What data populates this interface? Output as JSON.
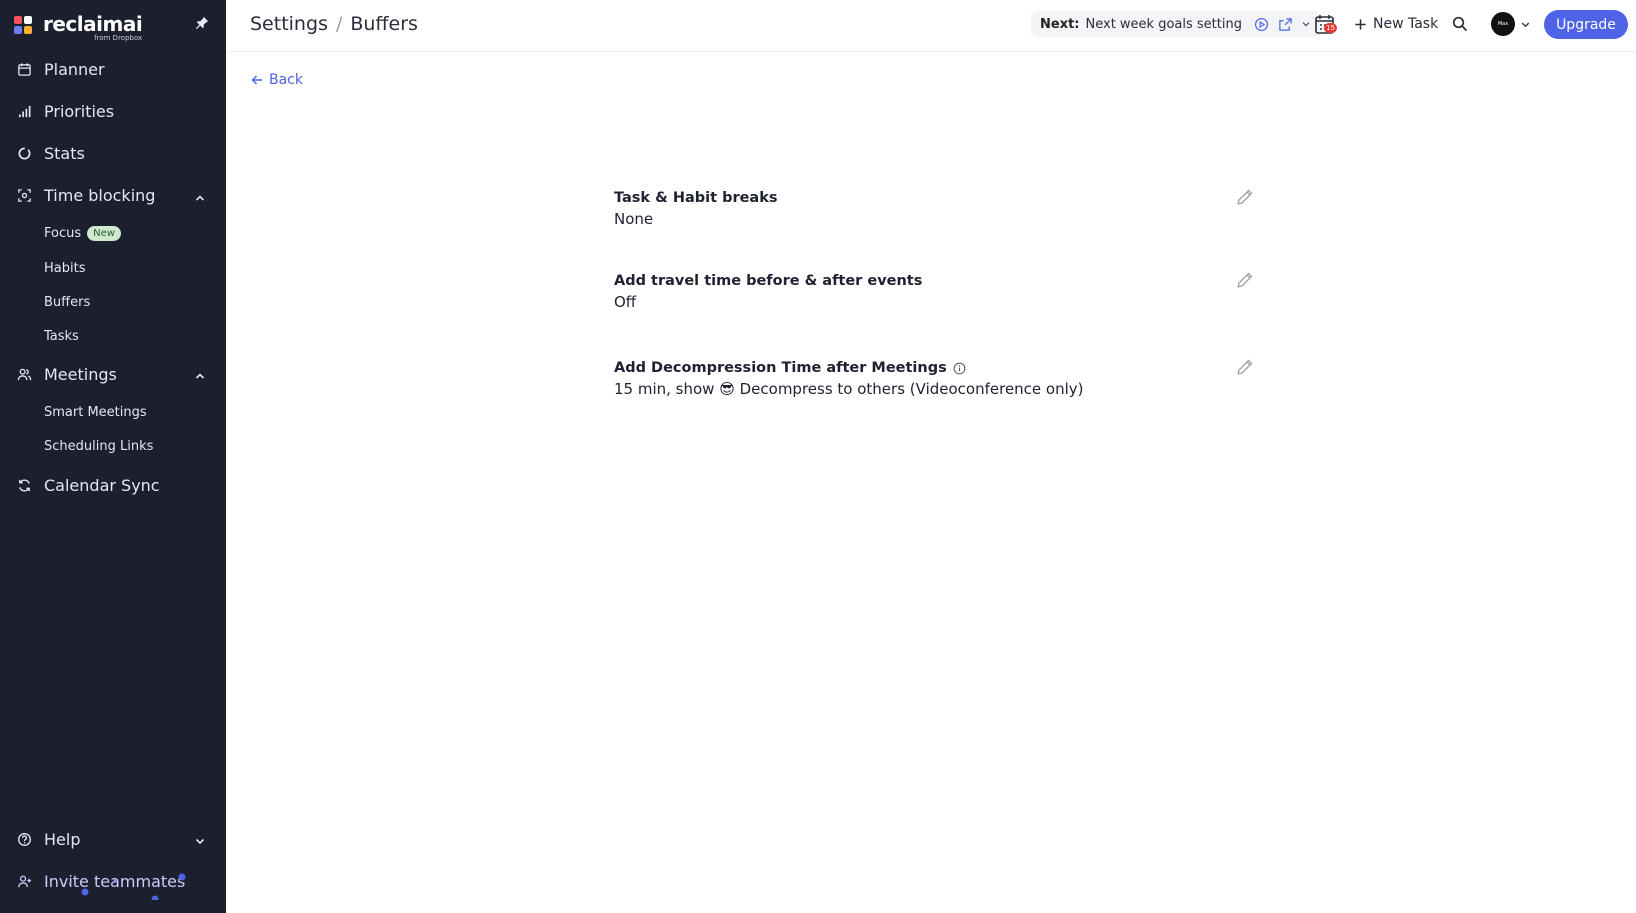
{
  "sidebar": {
    "logo_name": "reclaimai",
    "logo_sub": "from Dropbox",
    "nav": {
      "planner": "Planner",
      "priorities": "Priorities",
      "stats": "Stats",
      "time_blocking": "Time blocking",
      "focus": "Focus",
      "focus_badge": "New",
      "habits": "Habits",
      "buffers": "Buffers",
      "tasks": "Tasks",
      "meetings": "Meetings",
      "smart_meetings": "Smart Meetings",
      "scheduling_links": "Scheduling Links",
      "calendar_sync": "Calendar Sync",
      "help": "Help",
      "invite": "Invite teammates"
    }
  },
  "header": {
    "breadcrumb_root": "Settings",
    "breadcrumb_sep": "/",
    "breadcrumb_current": "Buffers",
    "next_label": "Next:",
    "next_event": "Next week goals setting",
    "calendar_count": "15",
    "new_task": "New Task",
    "avatar_text": "Max",
    "upgrade": "Upgrade"
  },
  "main": {
    "back": "Back",
    "settings": [
      {
        "title": "Task & Habit breaks",
        "value": "None"
      },
      {
        "title": "Add travel time before & after events",
        "value": "Off"
      },
      {
        "title": "Add Decompression Time after Meetings",
        "value": "15 min, show 😎 Decompress to others (Videoconference only)"
      }
    ]
  },
  "colors": {
    "sidebar_bg": "#1b1f2e",
    "accent": "#4f63e6",
    "badge_new_bg": "#cfe9cf"
  }
}
